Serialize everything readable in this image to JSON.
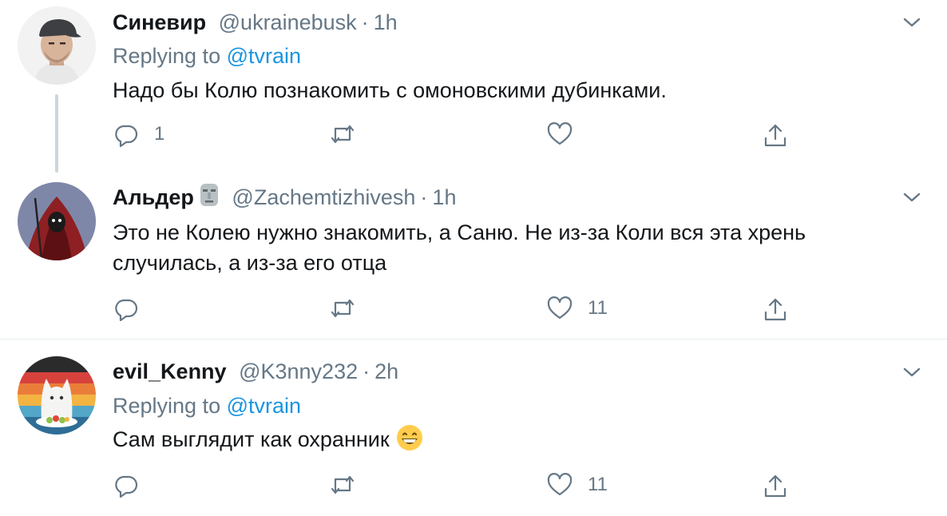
{
  "tweets": [
    {
      "name": "Синевир",
      "handle": "@ukrainebusk",
      "dot": "·",
      "time": "1h",
      "replying_prefix": "Replying to",
      "replying_to": "@tvrain",
      "text": "Надо бы Колю познакомить с омоновскими дубинками.",
      "reply_count": "1",
      "retweet_count": "",
      "like_count": ""
    },
    {
      "name": "Альдер",
      "name_emoji": "moai-emoji",
      "handle": "@Zachemtizhivesh",
      "dot": "·",
      "time": "1h",
      "text_line1": "Это не Колею нужно знакомить, а Саню. Не из-за Коли вся эта хрень",
      "text_line2": "случилась, а из-за его отца",
      "reply_count": "",
      "retweet_count": "",
      "like_count": "11"
    },
    {
      "name": "evil_Kenny",
      "handle": "@K3nny232",
      "dot": "·",
      "time": "2h",
      "replying_prefix": "Replying to",
      "replying_to": "@tvrain",
      "text": "Сам выглядит как охранник",
      "text_emoji": "grinning-face-emoji",
      "reply_count": "",
      "retweet_count": "",
      "like_count": "11"
    }
  ],
  "colors": {
    "text": "#14171a",
    "secondary": "#657786",
    "link": "#1b95e0",
    "border": "#e6ecf0",
    "thread": "#ccd6dd"
  },
  "icons": [
    "reply-icon",
    "retweet-icon",
    "like-icon",
    "share-icon",
    "chevron-down-icon"
  ]
}
